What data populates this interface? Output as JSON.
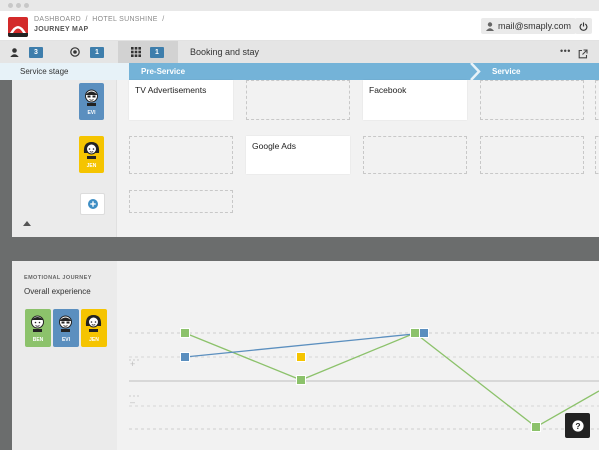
{
  "breadcrumb": {
    "dashboard": "DASHBOARD",
    "project": "HOTEL SUNSHINE",
    "current": "JOURNEY MAP"
  },
  "user": {
    "email": "mail@smaply.com"
  },
  "toolbar": {
    "personas_count": "3",
    "channels_count": "1",
    "stages_count": "1",
    "active_view_label": "Booking and stay",
    "more_label": "•••"
  },
  "stage_bar": {
    "label": "Service stage",
    "phases": [
      "Pre-Service",
      "Service"
    ]
  },
  "personas": [
    {
      "name": "BEN",
      "color": "#8cc26b"
    },
    {
      "name": "EVI",
      "color": "#5b8fbf"
    },
    {
      "name": "JEN",
      "color": "#f5c400"
    }
  ],
  "lanes": {
    "row1_cards": [
      "TV Advertisements",
      "Facebook"
    ],
    "row2_cards": [
      "Google Ads"
    ]
  },
  "emotional_journey": {
    "section_label": "EMOTIONAL JOURNEY",
    "title": "Overall experience"
  },
  "colors": {
    "brand_red": "#d32a2a",
    "accent_blue": "#3e7eac",
    "phase_blue": "#74b3d8",
    "ben_green": "#8cc26b",
    "evi_blue": "#5b8fbf",
    "jen_yellow": "#f5c400"
  },
  "icons": [
    "logo-icon",
    "user-icon",
    "power-icon",
    "persona-icon",
    "channel-icon",
    "grid-icon",
    "share-icon",
    "add-icon",
    "help-icon"
  ]
}
